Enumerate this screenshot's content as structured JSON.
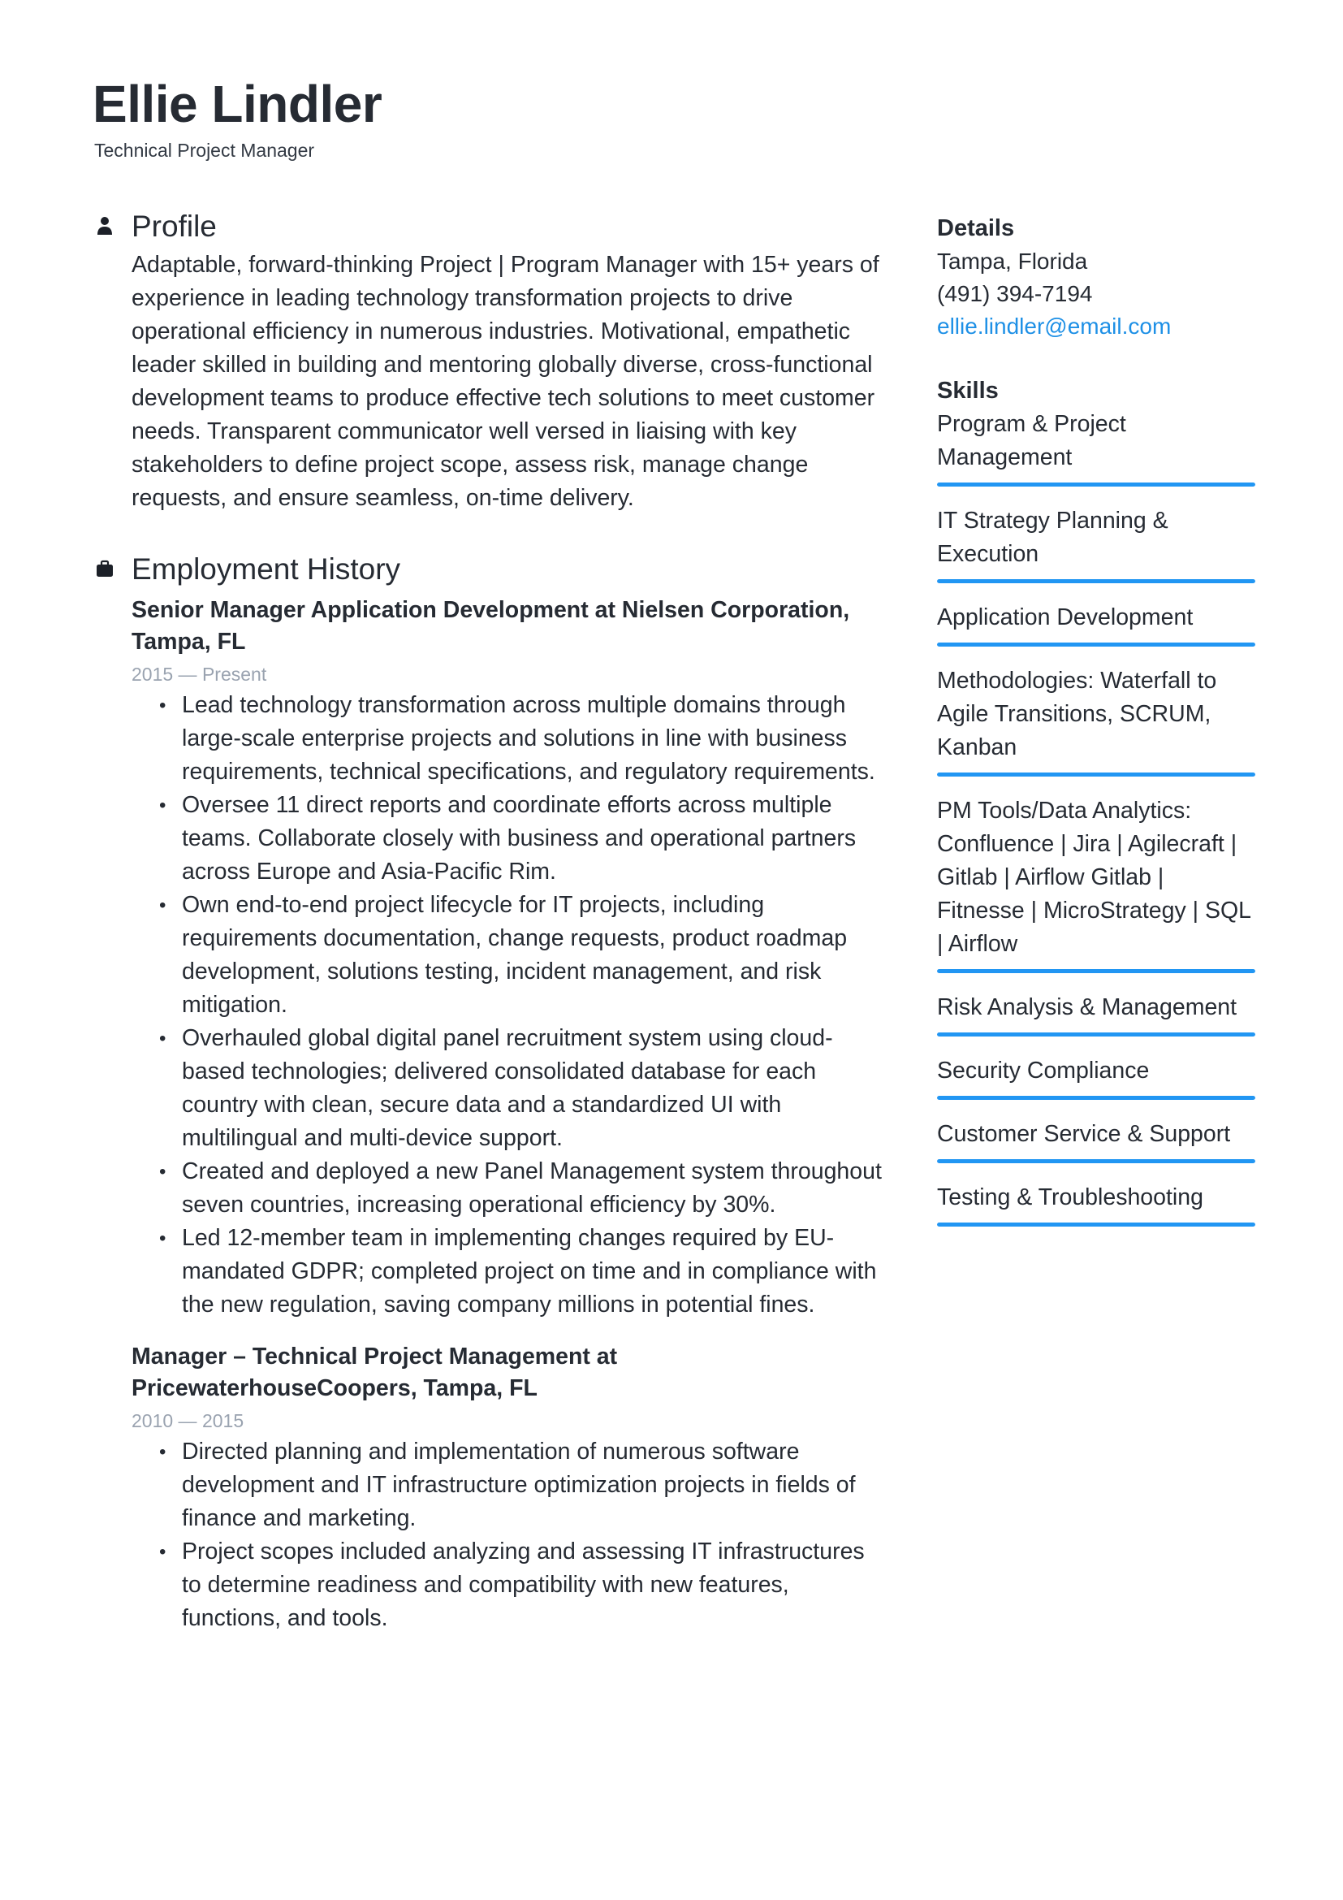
{
  "header": {
    "name": "Ellie Lindler",
    "job_title": "Technical Project Manager"
  },
  "profile": {
    "heading": "Profile",
    "icon": "person-icon",
    "text": "Adaptable, forward-thinking Project | Program Manager with 15+ years of experience in leading technology transformation projects to drive operational efficiency in numerous industries. Motivational, empathetic leader skilled in building and mentoring globally diverse, cross-functional development teams to produce effective tech solutions to meet customer needs. Transparent communicator well versed in liaising with key stakeholders to define project scope, assess risk, manage change requests, and ensure seamless, on-time delivery."
  },
  "employment": {
    "heading": "Employment History",
    "icon": "briefcase-icon",
    "jobs": [
      {
        "title": "Senior Manager Application Development at Nielsen Corporation, Tampa, FL",
        "dates": "2015 — Present",
        "bullets": [
          "Lead technology transformation across multiple domains through large-scale enterprise projects and solutions in line with business requirements, technical specifications, and regulatory requirements.",
          "Oversee 11 direct reports and coordinate efforts across multiple teams. Collaborate closely with business and operational partners across Europe and Asia-Pacific Rim.",
          "Own end-to-end project lifecycle for IT projects, including requirements documentation, change requests, product roadmap development, solutions testing, incident management, and risk mitigation.",
          "Overhauled global digital panel recruitment system using cloud-based technologies; delivered consolidated database for each country with clean, secure data and a standardized UI with multilingual and multi-device support.",
          "Created and deployed a new Panel Management system throughout  seven countries, increasing operational efficiency by 30%.",
          "Led 12-member team in implementing changes required by EU-mandated GDPR; completed project on time and in compliance with the new regulation, saving company millions in potential fines."
        ]
      },
      {
        "title": "Manager – Technical Project Management at PricewaterhouseCoopers, Tampa, FL",
        "dates": "2010 — 2015",
        "bullets": [
          "Directed planning and implementation of numerous software development and IT infrastructure optimization projects in fields of finance and marketing.",
          "Project scopes included analyzing and assessing IT infrastructures to determine readiness and compatibility with new features, functions, and tools."
        ]
      }
    ]
  },
  "details": {
    "heading": "Details",
    "location": "Tampa, Florida",
    "phone": "(491) 394-7194",
    "email": "ellie.lindler@email.com"
  },
  "skills": {
    "heading": "Skills",
    "accent_color": "#2196f3",
    "items": [
      {
        "name": "Program & Project Management",
        "level": 1.0
      },
      {
        "name": "IT Strategy Planning & Execution",
        "level": 1.0
      },
      {
        "name": "Application Development",
        "level": 1.0
      },
      {
        "name": "Methodologies: Waterfall to Agile Transitions, SCRUM, Kanban",
        "level": 1.0
      },
      {
        "name": "PM Tools/Data Analytics: Confluence | Jira | Agilecraft | Gitlab | Airflow Gitlab | Fitnesse | MicroStrategy | SQL | Airflow",
        "level": 1.0
      },
      {
        "name": "Risk Analysis & Management",
        "level": 1.0
      },
      {
        "name": "Security Compliance",
        "level": 1.0
      },
      {
        "name": "Customer Service & Support",
        "level": 1.0
      },
      {
        "name": "Testing & Troubleshooting",
        "level": 1.0
      }
    ]
  }
}
